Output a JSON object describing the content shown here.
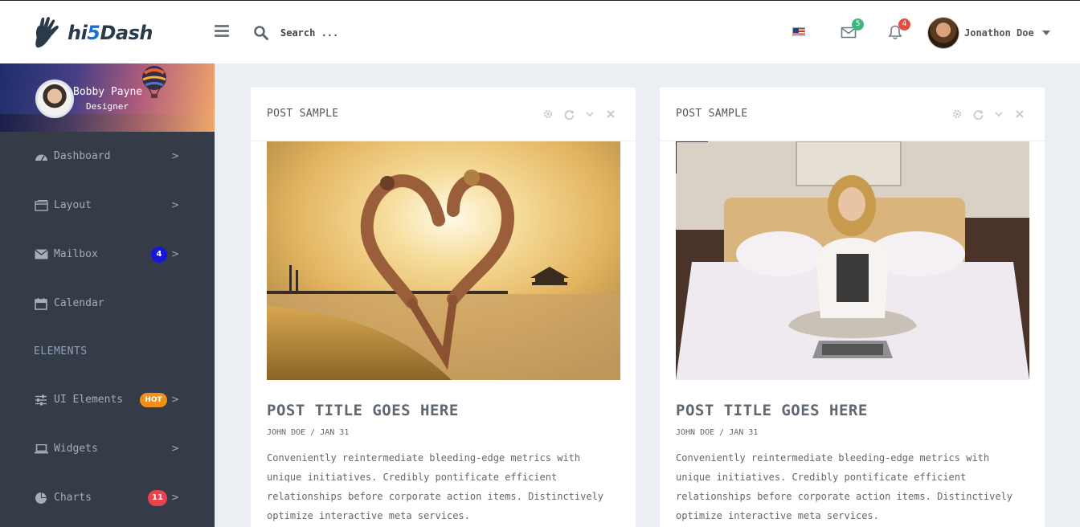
{
  "brand": {
    "logo_prefix": "hi",
    "logo_five": "5",
    "logo_suffix": "Dash"
  },
  "header": {
    "search_placeholder": "Search ...",
    "mail_count": "5",
    "notification_count": "4",
    "user_name": "Jonathon Doe",
    "language_icon": "us-flag-icon"
  },
  "profile": {
    "name": "Bobby Payne",
    "role": "Designer"
  },
  "sidebar": {
    "items": [
      {
        "label": "Dashboard",
        "icon": "dashboard-icon",
        "has_chevron": true
      },
      {
        "label": "Layout",
        "icon": "layout-icon",
        "has_chevron": true
      },
      {
        "label": "Mailbox",
        "icon": "envelope-icon",
        "badge": "4",
        "badge_color": "#1616d8",
        "has_chevron": true
      },
      {
        "label": "Calendar",
        "icon": "calendar-icon",
        "has_chevron": false
      }
    ],
    "section_header": "ELEMENTS",
    "elements_items": [
      {
        "label": "UI Elements",
        "icon": "sliders-icon",
        "badge": "HOT",
        "badge_color": "#f0901b",
        "has_chevron": true
      },
      {
        "label": "Widgets",
        "icon": "laptop-icon",
        "has_chevron": true
      },
      {
        "label": "Charts",
        "icon": "pie-chart-icon",
        "badge": "11",
        "badge_color": "#e8434e",
        "has_chevron": true
      }
    ]
  },
  "cards": [
    {
      "header": "POST SAMPLE",
      "image": "heart-jump-beach-photo",
      "title": "POST TITLE GOES HERE",
      "meta": "JOHN DOE / JAN 31",
      "body": "Conveniently reintermediate bleeding-edge metrics with unique initiatives. Credibly pontificate efficient relationships before corporate action items. Distinctively optimize interactive meta services."
    },
    {
      "header": "POST SAMPLE",
      "image": "woman-laptop-bed-photo",
      "title": "POST TITLE GOES HERE",
      "meta": "JOHN DOE / JAN 31",
      "body": "Conveniently reintermediate bleeding-edge metrics with unique initiatives. Credibly pontificate efficient relationships before corporate action items. Distinctively optimize interactive meta services."
    }
  ],
  "colors": {
    "sidebar_bg": "#353c48",
    "page_bg": "#ebeef2",
    "brand_blue": "#1f6fd1"
  }
}
